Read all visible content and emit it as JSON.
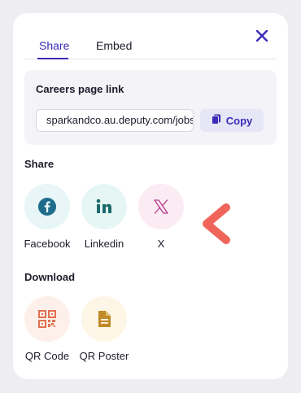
{
  "tabs": [
    {
      "label": "Share",
      "active": true
    },
    {
      "label": "Embed",
      "active": false
    }
  ],
  "careers_link": {
    "title": "Careers page link",
    "url": "sparkandco.au.deputy.com/jobs",
    "copy_label": "Copy"
  },
  "share": {
    "heading": "Share",
    "items": [
      {
        "label": "Facebook",
        "icon": "facebook-icon",
        "bg": "#e8f6f8",
        "color": "#1f6b8a"
      },
      {
        "label": "Linkedin",
        "icon": "linkedin-icon",
        "bg": "#e6f6f4",
        "color": "#1b6b6b"
      },
      {
        "label": "X",
        "icon": "x-icon",
        "bg": "#fbecf4",
        "color": "#b33a8a"
      }
    ]
  },
  "download": {
    "heading": "Download",
    "items": [
      {
        "label": "QR Code",
        "icon": "qr-code-icon",
        "bg": "#fdf0ea",
        "color": "#e0704f"
      },
      {
        "label": "QR Poster",
        "icon": "document-icon",
        "bg": "#fdf5e6",
        "color": "#c08a2a"
      }
    ]
  },
  "colors": {
    "accent": "#3a2bb8",
    "pointer_arrow": "#f0655a"
  }
}
